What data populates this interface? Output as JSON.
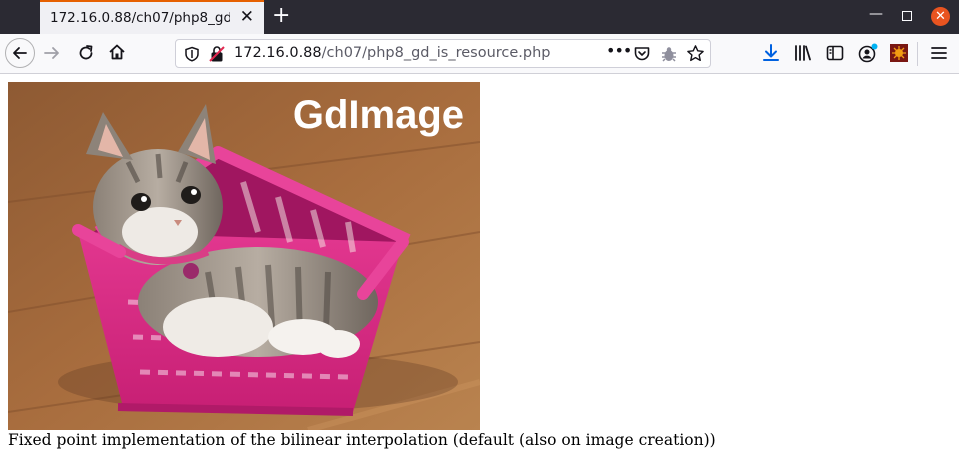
{
  "browser": {
    "tab": {
      "title": "172.16.0.88/ch07/php8_gd_"
    },
    "url": {
      "host": "172.16.0.88",
      "path": "/ch07/php8_gd_is_resource.php"
    }
  },
  "page": {
    "image_label": "GdImage",
    "caption": "Fixed point implementation of the bilinear interpolation (default (also on image creation))"
  }
}
